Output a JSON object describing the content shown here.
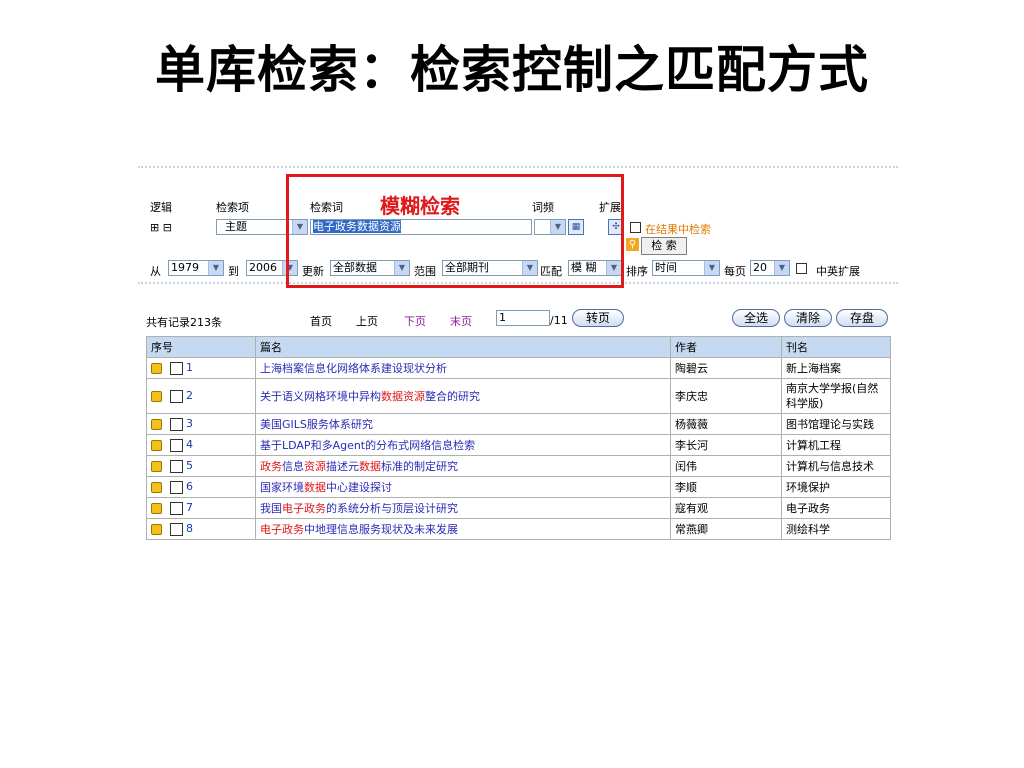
{
  "slide_title": "单库检索：检索控制之匹配方式",
  "annotation": "模糊检索",
  "search": {
    "headers": {
      "logic": "逻辑",
      "field": "检索项",
      "term": "检索词",
      "freq": "词频",
      "expand": "扩展"
    },
    "logic_toggle": "⊞ ⊟",
    "field_value": "主题",
    "term_value": "电子政务数据资源",
    "in_results_label": "在结果中检索",
    "search_button": "检 索",
    "from_label": "从",
    "year_from": "1979",
    "to_label": "到",
    "year_to": "2006",
    "update_label": "更新",
    "update_value": "全部数据",
    "scope_label": "范围",
    "scope_value": "全部期刊",
    "match_label": "匹配",
    "match_value": "模 糊",
    "sort_label": "排序",
    "sort_value": "时间",
    "per_page_label": "每页",
    "per_page_value": "20",
    "bilingual_label": "中英扩展"
  },
  "pager": {
    "total": "共有记录213条",
    "first": "首页",
    "prev": "上页",
    "next": "下页",
    "last": "末页",
    "page_input": "1",
    "page_total": "/11",
    "goto": "转页",
    "select_all": "全选",
    "clear": "清除",
    "save": "存盘"
  },
  "table": {
    "columns": [
      "序号",
      "篇名",
      "作者",
      "刊名"
    ],
    "rows": [
      {
        "num": "1",
        "title": [
          [
            "上海档案信息化网络体系建设现状分析",
            false
          ]
        ],
        "author": "陶碧云",
        "journal": "新上海档案"
      },
      {
        "num": "2",
        "title": [
          [
            "关于语义网格环境中异构",
            false
          ],
          [
            "数据资源",
            true
          ],
          [
            "整合的研究",
            false
          ]
        ],
        "author": "李庆忠",
        "journal": "南京大学学报(自然科学版)"
      },
      {
        "num": "3",
        "title": [
          [
            "美国GILS服务体系研究",
            false
          ]
        ],
        "author": "杨薇薇",
        "journal": "图书馆理论与实践"
      },
      {
        "num": "4",
        "title": [
          [
            "基于LDAP和多Agent的分布式网络信息检索",
            false
          ]
        ],
        "author": "李长河",
        "journal": "计算机工程"
      },
      {
        "num": "5",
        "title": [
          [
            "政务",
            true
          ],
          [
            "信息",
            false
          ],
          [
            "资源",
            true
          ],
          [
            "描述元",
            false
          ],
          [
            "数据",
            true
          ],
          [
            "标准的制定研究",
            false
          ]
        ],
        "author": "闰伟",
        "journal": "计算机与信息技术"
      },
      {
        "num": "6",
        "title": [
          [
            "国家环境",
            false
          ],
          [
            "数据",
            true
          ],
          [
            "中心建设探讨",
            false
          ]
        ],
        "author": "李顺",
        "journal": "环境保护"
      },
      {
        "num": "7",
        "title": [
          [
            "我国",
            false
          ],
          [
            "电子政务",
            true
          ],
          [
            "的系统分析与顶层设计研究",
            false
          ]
        ],
        "author": "寇有观",
        "journal": "电子政务"
      },
      {
        "num": "8",
        "title": [
          [
            "电子政务",
            true
          ],
          [
            "中地理信息服务现状及未来发展",
            false
          ]
        ],
        "author": "常燕卿",
        "journal": "测绘科学"
      }
    ]
  },
  "colors": {
    "highlight": "#e0191b",
    "link": "#2b2bb5",
    "header_bg": "#c5d9f1"
  }
}
